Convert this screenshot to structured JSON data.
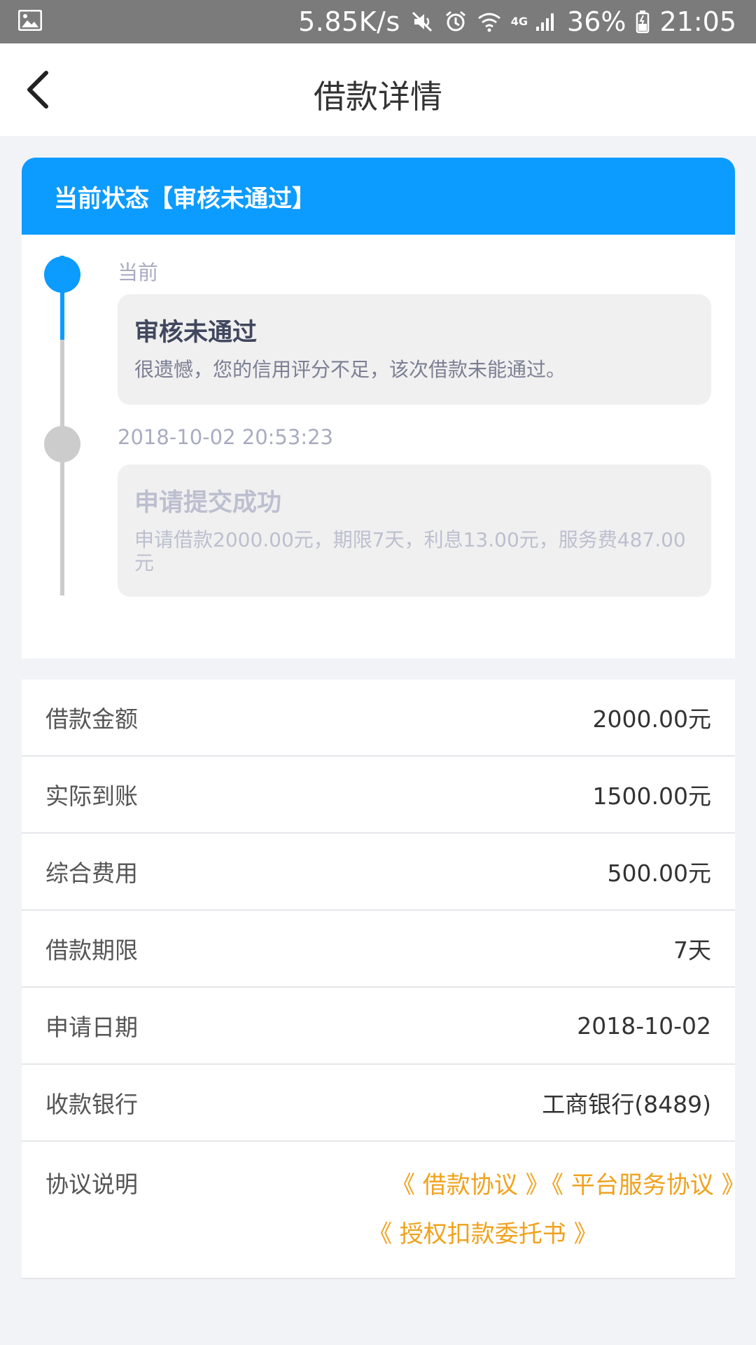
{
  "status_bar": {
    "net_speed": "5.85K/s",
    "network_type": "4G",
    "battery": "36%",
    "time": "21:05",
    "icons": [
      "image-icon",
      "mute-icon",
      "alarm-icon",
      "wifi-icon",
      "signal-icon",
      "battery-icon"
    ]
  },
  "header": {
    "title": "借款详情",
    "back_icon": "chevron-left-icon"
  },
  "status_card": {
    "heading": "当前状态【审核未通过】",
    "steps": [
      {
        "time": "当前",
        "title": "审核未通过",
        "desc": "很遗憾，您的信用评分不足，该次借款未能通过。"
      },
      {
        "time": "2018-10-02 20:53:23",
        "title": "申请提交成功",
        "desc": "申请借款2000.00元，期限7天，利息13.00元，服务费487.00元"
      }
    ]
  },
  "details": [
    {
      "label": "借款金额",
      "value": "2000.00元"
    },
    {
      "label": "实际到账",
      "value": "1500.00元"
    },
    {
      "label": "综合费用",
      "value": "500.00元"
    },
    {
      "label": "借款期限",
      "value": "7天"
    },
    {
      "label": "申请日期",
      "value": "2018-10-02"
    },
    {
      "label": "收款银行",
      "value": "工商银行(8489)"
    }
  ],
  "agreement": {
    "label": "协议说明",
    "links": [
      "《 借款协议 》",
      "《 平台服务协议 》",
      "《 授权扣款委托书 》"
    ]
  },
  "colors": {
    "accent": "#0c9bff",
    "link": "#f0a21d",
    "status_bar": "#7b7b7b",
    "timeline_inactive": "#cccccc",
    "background": "#f2f3f7"
  }
}
